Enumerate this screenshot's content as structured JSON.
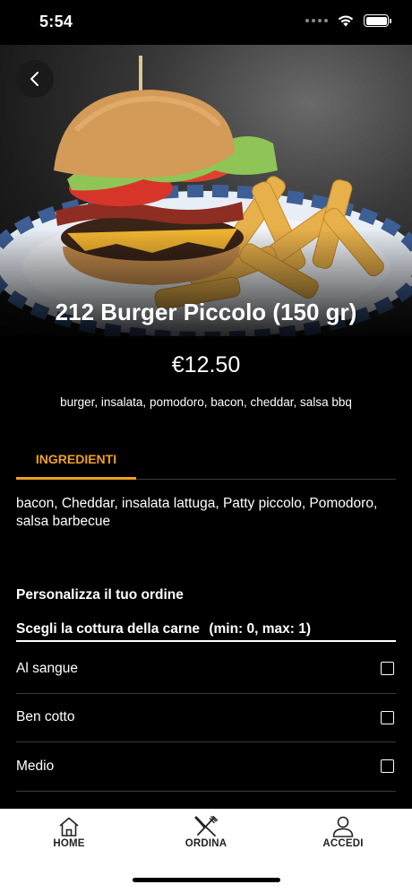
{
  "status_bar": {
    "time": "5:54"
  },
  "product": {
    "name": "212 Burger Piccolo (150 gr)",
    "price": "€12.50",
    "description": "burger, insalata, pomodoro, bacon, cheddar, salsa bbq"
  },
  "tabs": [
    {
      "label": "INGREDIENTI",
      "active": true
    }
  ],
  "ingredients": "bacon, Cheddar, insalata lattuga, Patty piccolo, Pomodoro, salsa barbecue",
  "customize": {
    "title": "Personalizza il tuo ordine",
    "group_name": "Scegli la cottura della carne",
    "group_limits": "(min: 0, max: 1)",
    "options": [
      {
        "label": "Al sangue",
        "checked": false
      },
      {
        "label": "Ben cotto",
        "checked": false
      },
      {
        "label": "Medio",
        "checked": false
      }
    ]
  },
  "nav": {
    "home": "HOME",
    "ordina": "ORDINA",
    "accedi": "ACCEDI"
  },
  "colors": {
    "accent": "#f0a022",
    "background": "#000000",
    "nav_background": "#ffffff"
  }
}
